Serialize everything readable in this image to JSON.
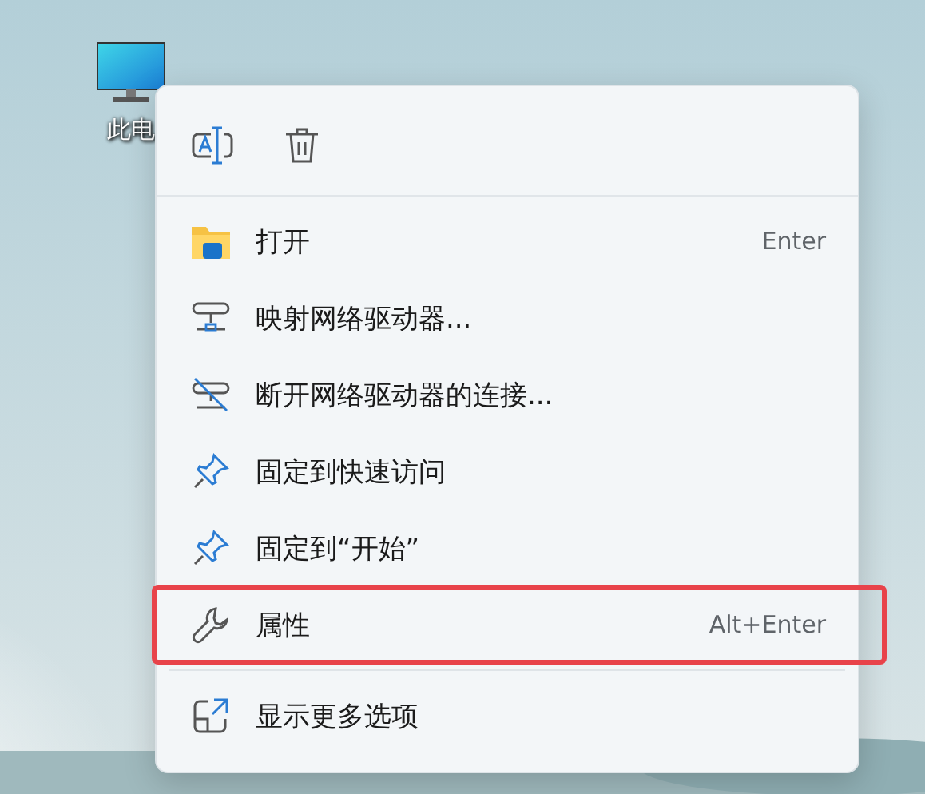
{
  "desktop_icons": [
    {
      "label": "此电"
    }
  ],
  "menu": {
    "toolbar": [
      {
        "kind": "rename"
      },
      {
        "kind": "delete"
      }
    ],
    "sections": [
      [
        {
          "kind": "folder",
          "label": "打开",
          "shortcut": "Enter",
          "highlighted": false
        },
        {
          "kind": "map-drive",
          "label": "映射网络驱动器...",
          "highlighted": false
        },
        {
          "kind": "disconnect-drive",
          "label": "断开网络驱动器的连接...",
          "highlighted": false
        },
        {
          "kind": "pin",
          "label": "固定到快速访问",
          "highlighted": false
        },
        {
          "kind": "pin",
          "label": "固定到“开始”",
          "highlighted": false
        },
        {
          "kind": "wrench",
          "label": "属性",
          "shortcut": "Alt+Enter",
          "highlighted": true
        }
      ],
      [
        {
          "kind": "more",
          "label": "显示更多选项",
          "highlighted": false
        }
      ]
    ]
  }
}
